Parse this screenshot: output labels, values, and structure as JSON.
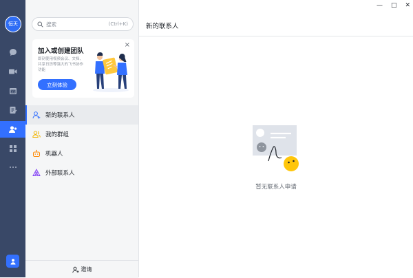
{
  "app": {
    "avatar_text": "恒天",
    "rail_icons": [
      "chat-icon",
      "video-icon",
      "calendar-icon",
      "docs-icon",
      "contacts-icon",
      "apps-icon",
      "more-icon"
    ],
    "active_rail": "contacts-icon",
    "accent_color": "#3370ff",
    "rail_color": "#394867"
  },
  "window_controls": {
    "minimize": "—",
    "maximize": "□",
    "close": "✕"
  },
  "search": {
    "placeholder": "搜索",
    "shortcut": "(Ctrl+K)"
  },
  "promo": {
    "title": "加入或创建团队",
    "description": "即刻使用视频会议、文档、共享日历等强大的飞书协作功能",
    "button": "立刻体验",
    "close": "×"
  },
  "nav": {
    "items": [
      {
        "label": "新的联系人",
        "icon": "new-contact-icon",
        "active": true
      },
      {
        "label": "我的群组",
        "icon": "groups-icon",
        "active": false
      },
      {
        "label": "机器人",
        "icon": "bot-icon",
        "active": false
      },
      {
        "label": "外部联系人",
        "icon": "external-contact-icon",
        "active": false
      }
    ],
    "invite": "邀请"
  },
  "main": {
    "title": "新的联系人",
    "empty_text": "暂无联系人申请"
  }
}
